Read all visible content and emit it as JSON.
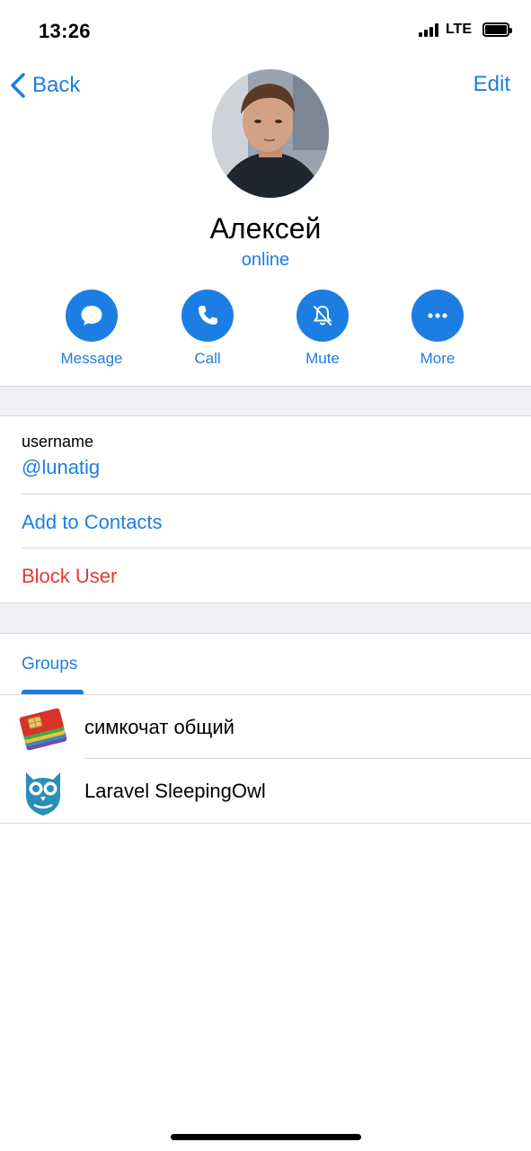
{
  "status_bar": {
    "time": "13:26",
    "network": "LTE"
  },
  "nav": {
    "back_label": "Back",
    "edit_label": "Edit"
  },
  "profile": {
    "name": "Алексей",
    "status": "online"
  },
  "actions": [
    {
      "label": "Message",
      "icon": "message-bubble-icon"
    },
    {
      "label": "Call",
      "icon": "phone-icon"
    },
    {
      "label": "Mute",
      "icon": "bell-slash-icon"
    },
    {
      "label": "More",
      "icon": "ellipsis-icon"
    }
  ],
  "info": {
    "username_label": "username",
    "username_value": "@lunatig",
    "add_contact": "Add to Contacts",
    "block_user": "Block User"
  },
  "tabs": {
    "groups": "Groups"
  },
  "groups": [
    {
      "title": "симкочат общий",
      "icon": "sim-cards-icon"
    },
    {
      "title": "Laravel SleepingOwl",
      "icon": "owl-logo-icon"
    }
  ],
  "colors": {
    "accent": "#1c7ee3",
    "danger": "#e53935",
    "separator_bg": "#efeff4"
  }
}
